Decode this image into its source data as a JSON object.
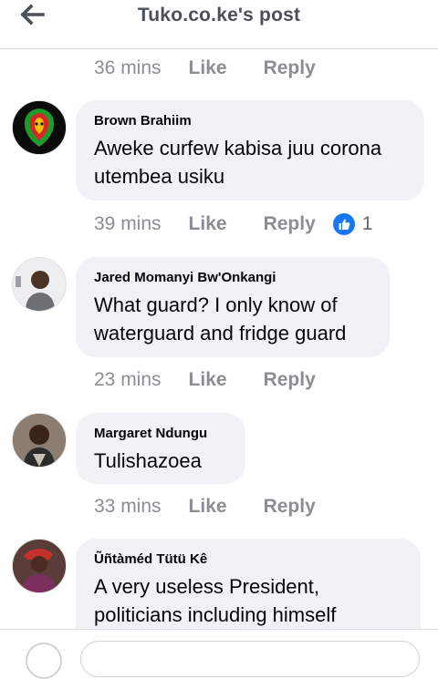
{
  "header": {
    "title": "Tuko.co.ke's post"
  },
  "actions": {
    "like_label": "Like",
    "reply_label": "Reply"
  },
  "top_meta": {
    "time": "36 mins"
  },
  "comments": [
    {
      "author": "Brown Brahiim",
      "text": "Aweke curfew kabisa juu corona utembea usiku",
      "time": "39 mins",
      "reaction_icon": "thumbs-up-icon",
      "reaction_count": "1"
    },
    {
      "author": "Jared Momanyi Bw'Onkangi",
      "text": "What guard? I only know of waterguard and fridge guard",
      "time": "23 mins"
    },
    {
      "author": "Margaret Ndungu",
      "text": "Tulishazoea",
      "time": "33 mins"
    },
    {
      "author": "Ũñtàméd Tütü Kê",
      "text": "A very useless President, politicians including himself"
    }
  ],
  "colors": {
    "bubble_bg": "#f0f2f5",
    "meta_text": "#8a8d91",
    "like_blue": "#1877f2"
  }
}
